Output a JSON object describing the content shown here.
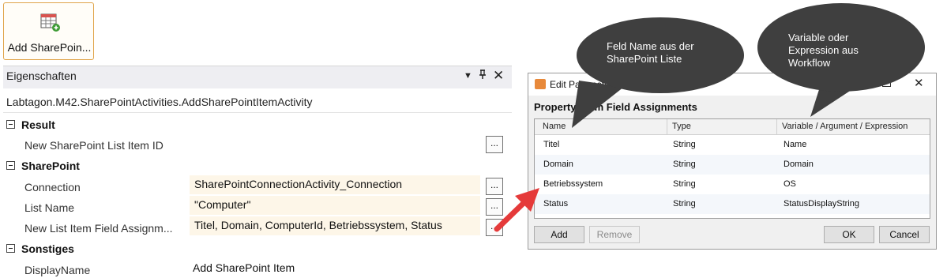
{
  "toolbox": {
    "tile_label": "Add SharePoin..."
  },
  "panel": {
    "title": "Eigenschaften",
    "class_name": "Labtagon.M42.SharePointActivities.AddSharePointItemActivity",
    "categories": {
      "result": "Result",
      "sharepoint": "SharePoint",
      "sonstiges": "Sonstiges"
    },
    "properties": {
      "item_id_label": "New SharePoint List Item ID",
      "connection_label": "Connection",
      "connection_value": "SharePointConnectionActivity_Connection",
      "list_name_label": "List Name",
      "list_name_value": "\"Computer\"",
      "assign_label": "New List Item Field Assignm...",
      "assign_value": "Titel, Domain, ComputerId, Betriebssystem, Status",
      "display_label": "DisplayName",
      "display_value": "Add SharePoint Item"
    },
    "dots_label": "..."
  },
  "dialog": {
    "title": "Edit Parameters",
    "property_prefix": "Property:",
    "property_value": "Li      m Field Assignments",
    "columns": [
      "Name",
      "Type",
      "Variable / Argument / Expression"
    ],
    "rows": [
      {
        "name": "Titel",
        "type": "String",
        "expr": "Name"
      },
      {
        "name": "Domain",
        "type": "String",
        "expr": "Domain"
      },
      {
        "name": "Betriebssystem",
        "type": "String",
        "expr": "OS"
      },
      {
        "name": "Status",
        "type": "String",
        "expr": "StatusDisplayString"
      }
    ],
    "buttons": {
      "add": "Add",
      "remove": "Remove",
      "ok": "OK",
      "cancel": "Cancel"
    }
  },
  "callouts": {
    "left_line1": "Feld Name aus der",
    "left_line2": "SharePoint Liste",
    "right_line1": "Variable oder",
    "right_line2": "Expression aus",
    "right_line3": "Workflow"
  },
  "colors": {
    "accent_border": "#e0a44a",
    "value_bg": "#fdf6e8",
    "callout_bg": "#3f3f3f",
    "arrow": "#e53a3a"
  }
}
